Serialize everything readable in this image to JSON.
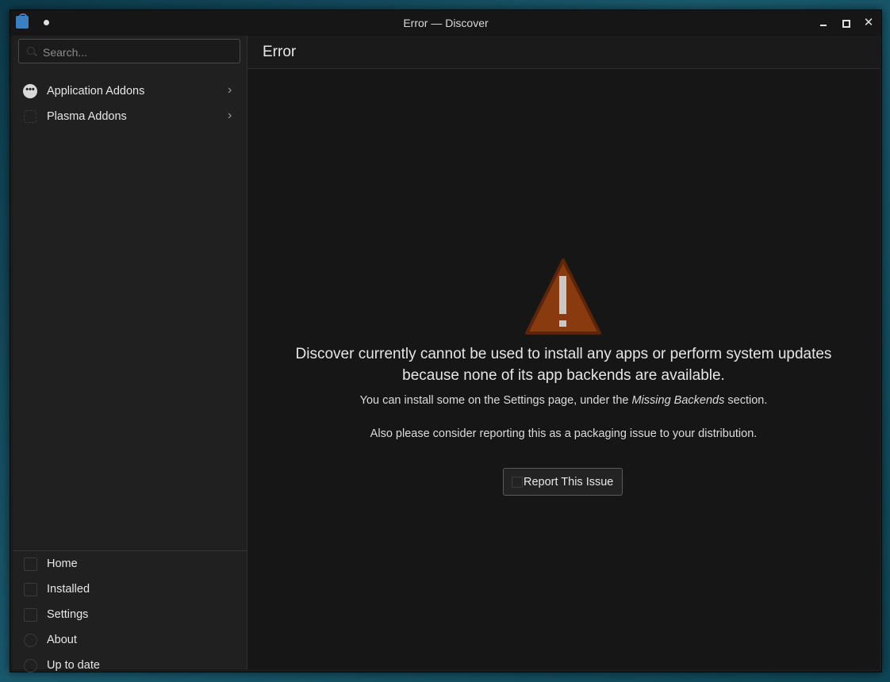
{
  "window": {
    "title": "Error — Discover"
  },
  "sidebar": {
    "search_placeholder": "Search...",
    "categories": [
      {
        "label": "Application Addons",
        "icon": "addons-icon"
      },
      {
        "label": "Plasma Addons",
        "icon": "puzzle-icon"
      }
    ],
    "bottom_nav": [
      {
        "label": "Home",
        "icon": "home-icon"
      },
      {
        "label": "Installed",
        "icon": "installed-icon"
      },
      {
        "label": "Settings",
        "icon": "settings-icon"
      },
      {
        "label": "About",
        "icon": "about-icon"
      },
      {
        "label": "Up to date",
        "icon": "update-icon"
      }
    ]
  },
  "main": {
    "page_title": "Error",
    "message": "Discover currently cannot be used to install any apps or perform system updates because none of its app backends are available.",
    "sub_before": "You can install some on the Settings page, under the ",
    "sub_em": "Missing Backends",
    "sub_after": " section.",
    "sub2": "Also please consider reporting this as a packaging issue to your distribution.",
    "report_button": "Report This Issue"
  },
  "colors": {
    "warning_fill": "#8a3a0f",
    "warning_border": "#5a2508",
    "window_bg": "#1b1b1b",
    "desktop_bg": "#1a5a6e"
  }
}
